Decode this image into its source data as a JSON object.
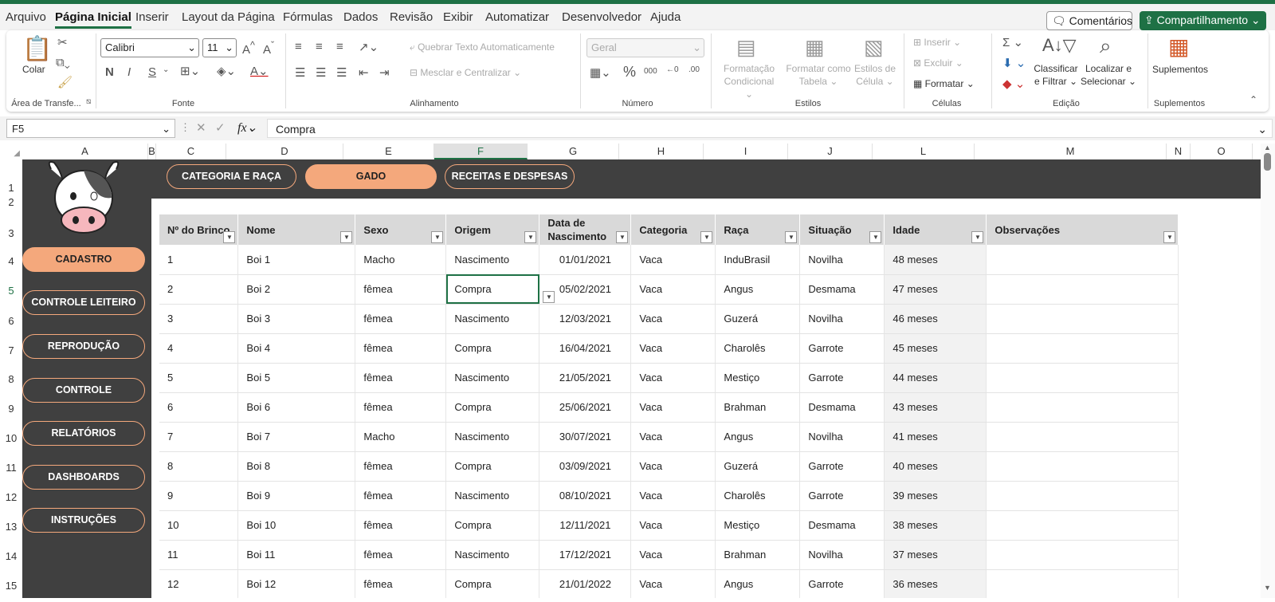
{
  "menu": {
    "items": [
      "Arquivo",
      "Página Inicial",
      "Inserir",
      "Layout da Página",
      "Fórmulas",
      "Dados",
      "Revisão",
      "Exibir",
      "Automatizar",
      "Desenvolvedor",
      "Ajuda"
    ],
    "comments": "Comentários",
    "share": "Compartilhamento"
  },
  "ribbon": {
    "paste": "Colar",
    "groups": {
      "clipboard": "Área de Transfe...",
      "font": "Fonte",
      "alignment": "Alinhamento",
      "number": "Número",
      "styles": "Estilos",
      "cells": "Células",
      "editing": "Edição",
      "addins": "Suplementos"
    },
    "font_name": "Calibri",
    "font_size": "11",
    "wrap_text": "Quebrar Texto Automaticamente",
    "merge_center": "Mesclar e Centralizar",
    "number_format": "Geral",
    "cond_format": [
      "Formatação",
      "Condicional"
    ],
    "format_table": [
      "Formatar como",
      "Tabela"
    ],
    "cell_styles": [
      "Estilos de",
      "Célula"
    ],
    "insert": "Inserir",
    "delete": "Excluir",
    "format": "Formatar",
    "sort_filter": [
      "Classificar",
      "e Filtrar"
    ],
    "find_select": [
      "Localizar e",
      "Selecionar"
    ],
    "addins": "Suplementos"
  },
  "formula_bar": {
    "name_box": "F5",
    "value": "Compra"
  },
  "columns": [
    "A",
    "B",
    "C",
    "D",
    "E",
    "F",
    "G",
    "H",
    "I",
    "J",
    "L",
    "M",
    "N",
    "O"
  ],
  "rows": [
    "1",
    "2",
    "3",
    "4",
    "5",
    "6",
    "7",
    "8",
    "9",
    "10",
    "11",
    "12",
    "13",
    "14",
    "15"
  ],
  "nav_top": [
    "CATEGORIA E RAÇA",
    "GADO",
    "RECEITAS E DESPESAS"
  ],
  "nav_side": [
    "CADASTRO",
    "CONTROLE LEITEIRO",
    "REPRODUÇÃO",
    "CONTROLE",
    "RELATÓRIOS",
    "DASHBOARDS",
    "INSTRUÇÕES"
  ],
  "table": {
    "headers": [
      "Nº do Brinco",
      "Nome",
      "Sexo",
      "Origem",
      "Data de Nascimento",
      "Categoria",
      "Raça",
      "Situação",
      "Idade",
      "Observações"
    ],
    "rows": [
      [
        "1",
        "Boi 1",
        "Macho",
        "Nascimento",
        "01/01/2021",
        "Vaca",
        "InduBrasil",
        "Novilha",
        "48 meses",
        ""
      ],
      [
        "2",
        "Boi 2",
        "fêmea",
        "Compra",
        "05/02/2021",
        "Vaca",
        "Angus",
        "Desmama",
        "47 meses",
        ""
      ],
      [
        "3",
        "Boi 3",
        "fêmea",
        "Nascimento",
        "12/03/2021",
        "Vaca",
        "Guzerá",
        "Novilha",
        "46 meses",
        ""
      ],
      [
        "4",
        "Boi 4",
        "fêmea",
        "Compra",
        "16/04/2021",
        "Vaca",
        "Charolês",
        "Garrote",
        "45 meses",
        ""
      ],
      [
        "5",
        "Boi 5",
        "fêmea",
        "Nascimento",
        "21/05/2021",
        "Vaca",
        "Mestiço",
        "Garrote",
        "44 meses",
        ""
      ],
      [
        "6",
        "Boi 6",
        "fêmea",
        "Compra",
        "25/06/2021",
        "Vaca",
        "Brahman",
        "Desmama",
        "43 meses",
        ""
      ],
      [
        "7",
        "Boi 7",
        "Macho",
        "Nascimento",
        "30/07/2021",
        "Vaca",
        "Angus",
        "Novilha",
        "41 meses",
        ""
      ],
      [
        "8",
        "Boi 8",
        "fêmea",
        "Compra",
        "03/09/2021",
        "Vaca",
        "Guzerá",
        "Garrote",
        "40 meses",
        ""
      ],
      [
        "9",
        "Boi 9",
        "fêmea",
        "Nascimento",
        "08/10/2021",
        "Vaca",
        "Charolês",
        "Garrote",
        "39 meses",
        ""
      ],
      [
        "10",
        "Boi 10",
        "fêmea",
        "Compra",
        "12/11/2021",
        "Vaca",
        "Mestiço",
        "Desmama",
        "38 meses",
        ""
      ],
      [
        "11",
        "Boi 11",
        "fêmea",
        "Nascimento",
        "17/12/2021",
        "Vaca",
        "Brahman",
        "Novilha",
        "37 meses",
        ""
      ],
      [
        "12",
        "Boi 12",
        "fêmea",
        "Compra",
        "21/01/2022",
        "Vaca",
        "Angus",
        "Garrote",
        "36 meses",
        ""
      ]
    ]
  },
  "colors": {
    "accent": "#1e7145",
    "pill": "#f4a87c",
    "panel": "#404040"
  }
}
